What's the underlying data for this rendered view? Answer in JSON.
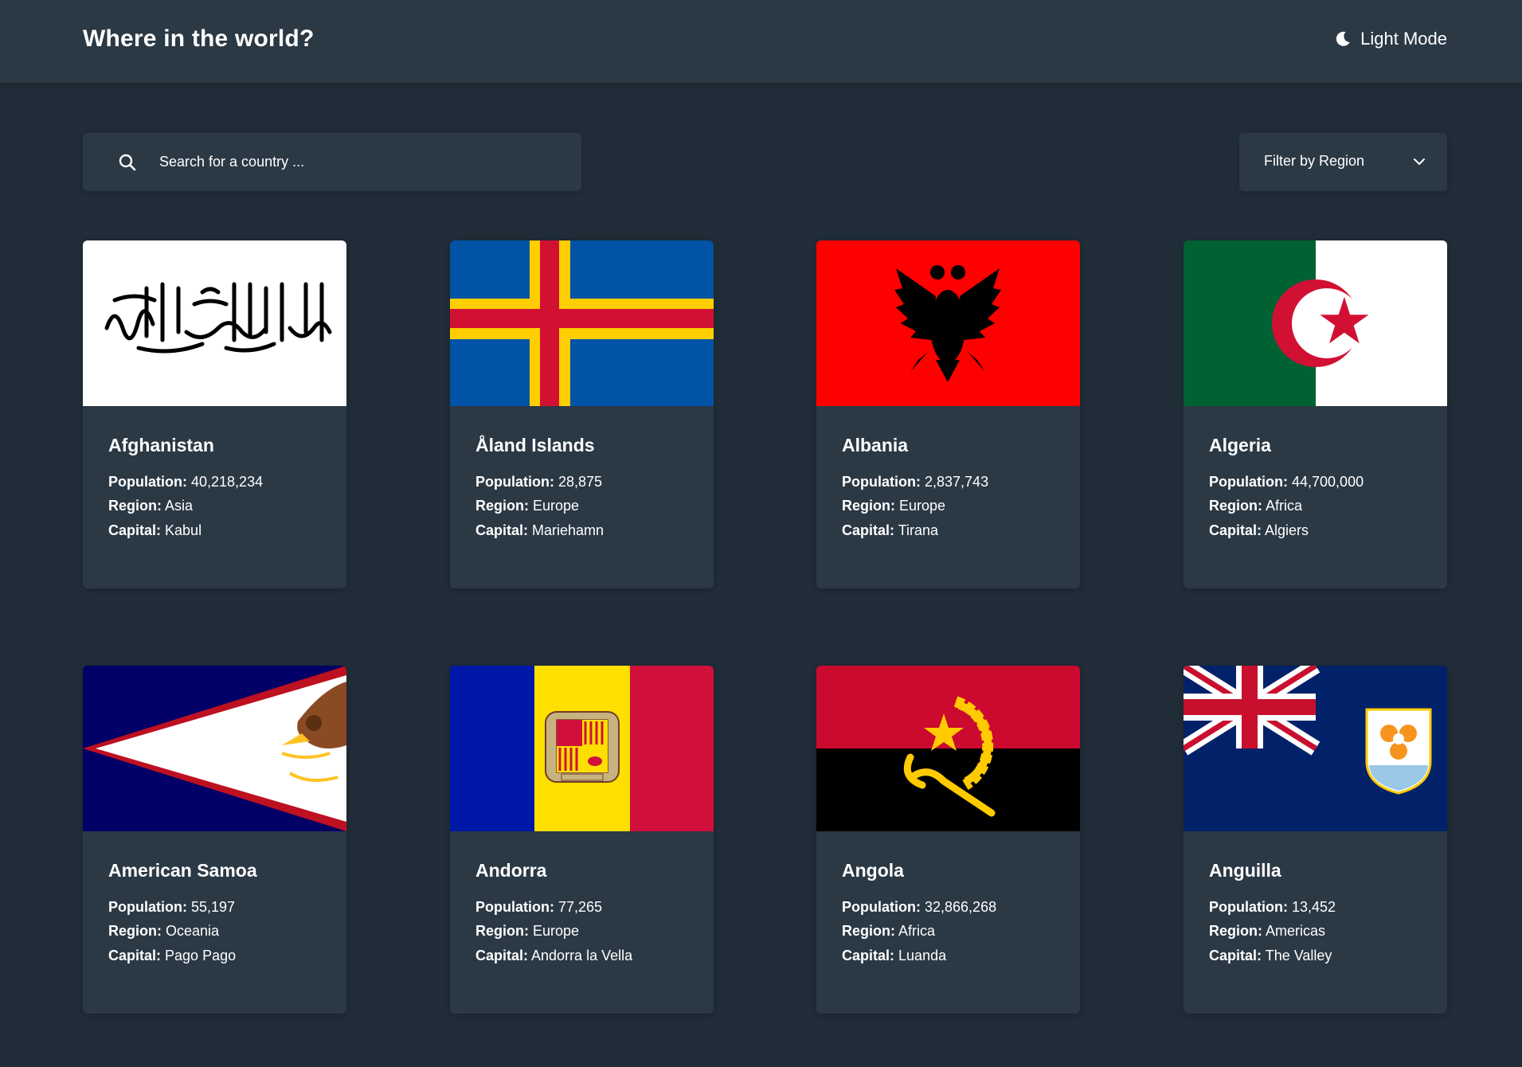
{
  "header": {
    "title": "Where in the world?",
    "mode_label": "Light Mode"
  },
  "search": {
    "placeholder": "Search for a country ..."
  },
  "filter": {
    "label": "Filter by Region"
  },
  "field_labels": {
    "population": "Population:",
    "region": "Region:",
    "capital": "Capital:"
  },
  "countries": [
    {
      "name": "Afghanistan",
      "population": "40,218,234",
      "region": "Asia",
      "capital": "Kabul"
    },
    {
      "name": "Åland Islands",
      "population": "28,875",
      "region": "Europe",
      "capital": "Mariehamn"
    },
    {
      "name": "Albania",
      "population": "2,837,743",
      "region": "Europe",
      "capital": "Tirana"
    },
    {
      "name": "Algeria",
      "population": "44,700,000",
      "region": "Africa",
      "capital": "Algiers"
    },
    {
      "name": "American Samoa",
      "population": "55,197",
      "region": "Oceania",
      "capital": "Pago Pago"
    },
    {
      "name": "Andorra",
      "population": "77,265",
      "region": "Europe",
      "capital": "Andorra la Vella"
    },
    {
      "name": "Angola",
      "population": "32,866,268",
      "region": "Africa",
      "capital": "Luanda"
    },
    {
      "name": "Anguilla",
      "population": "13,452",
      "region": "Americas",
      "capital": "The Valley"
    }
  ],
  "colors": {
    "background": "#202c37",
    "element": "#2b3945",
    "text": "#ffffff"
  }
}
